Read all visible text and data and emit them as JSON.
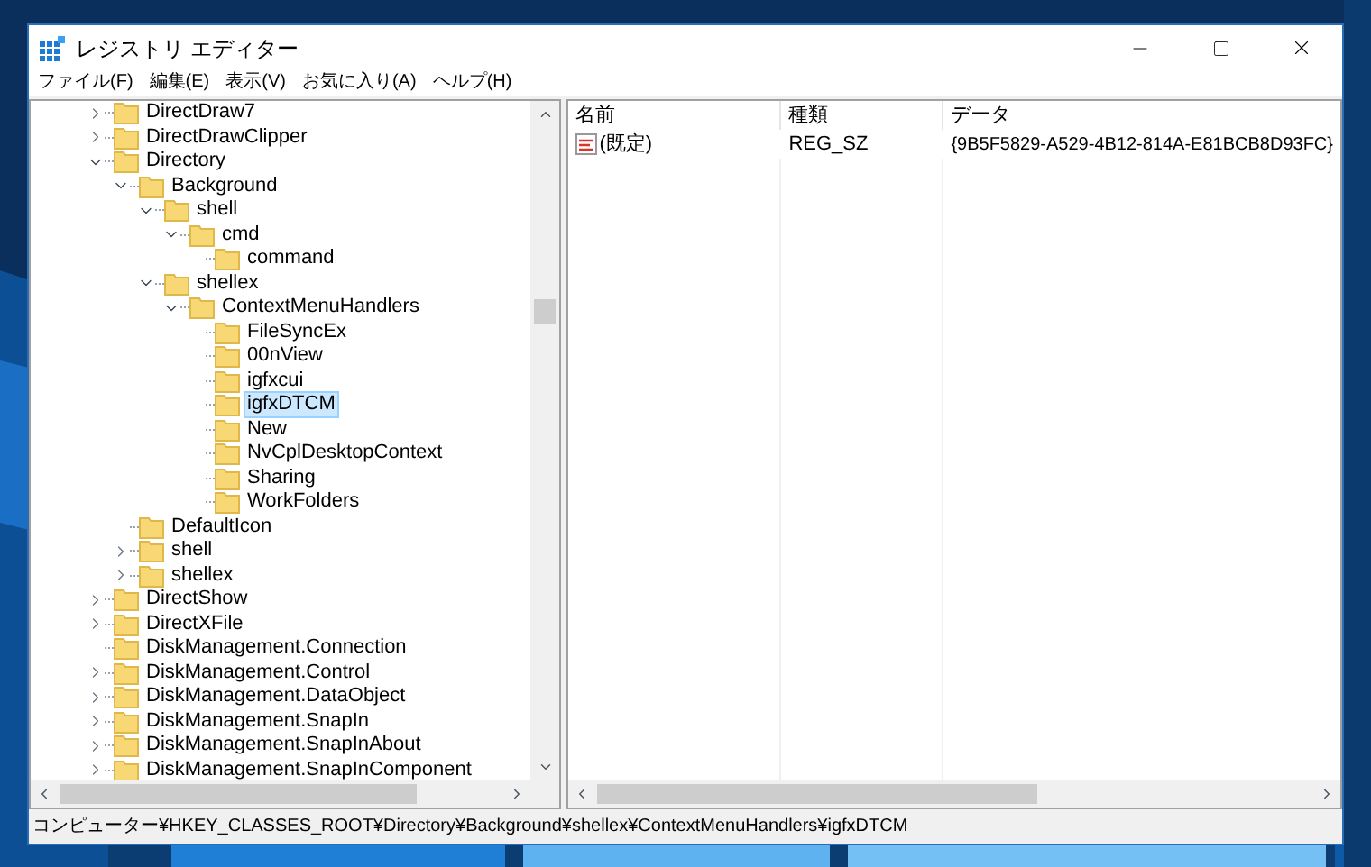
{
  "window": {
    "title": "レジストリ エディター"
  },
  "menu": [
    "ファイル(F)",
    "編集(E)",
    "表示(V)",
    "お気に入り(A)",
    "ヘルプ(H)"
  ],
  "tree": [
    {
      "name": "DirectDraw7",
      "expanded": false,
      "selected": false
    },
    {
      "name": "DirectDrawClipper",
      "expanded": false,
      "selected": false
    },
    {
      "name": "Directory",
      "expanded": true,
      "selected": false,
      "children": [
        {
          "name": "Background",
          "expanded": true,
          "selected": false,
          "children": [
            {
              "name": "shell",
              "expanded": true,
              "selected": false,
              "children": [
                {
                  "name": "cmd",
                  "expanded": true,
                  "selected": false,
                  "children": [
                    {
                      "name": "command",
                      "selected": false
                    }
                  ]
                }
              ]
            },
            {
              "name": "shellex",
              "expanded": true,
              "selected": false,
              "children": [
                {
                  "name": "ContextMenuHandlers",
                  "expanded": true,
                  "selected": false,
                  "children": [
                    {
                      "name": "FileSyncEx",
                      "selected": false
                    },
                    {
                      "name": "00nView",
                      "selected": false
                    },
                    {
                      "name": "igfxcui",
                      "selected": false
                    },
                    {
                      "name": "igfxDTCM",
                      "selected": true
                    },
                    {
                      "name": "New",
                      "selected": false
                    },
                    {
                      "name": "NvCplDesktopContext",
                      "selected": false
                    },
                    {
                      "name": "Sharing",
                      "selected": false
                    },
                    {
                      "name": "WorkFolders",
                      "selected": false
                    }
                  ]
                }
              ]
            }
          ]
        },
        {
          "name": "DefaultIcon",
          "selected": false
        },
        {
          "name": "shell",
          "expanded": false,
          "selected": false
        },
        {
          "name": "shellex",
          "expanded": false,
          "selected": false
        }
      ]
    },
    {
      "name": "DirectShow",
      "expanded": false,
      "selected": false
    },
    {
      "name": "DirectXFile",
      "expanded": false,
      "selected": false
    },
    {
      "name": "DiskManagement.Connection",
      "selected": false
    },
    {
      "name": "DiskManagement.Control",
      "expanded": false,
      "selected": false
    },
    {
      "name": "DiskManagement.DataObject",
      "expanded": false,
      "selected": false
    },
    {
      "name": "DiskManagement.SnapIn",
      "expanded": false,
      "selected": false
    },
    {
      "name": "DiskManagement.SnapInAbout",
      "expanded": false,
      "selected": false
    },
    {
      "name": "DiskManagement.SnapInComponent",
      "expanded": false,
      "selected": false
    }
  ],
  "values": {
    "columns": [
      "名前",
      "種類",
      "データ"
    ],
    "rows": [
      {
        "name": "(既定)",
        "type": "REG_SZ",
        "data": "{9B5F5829-A529-4B12-814A-E81BCB8D93FC}"
      }
    ]
  },
  "status_bar": "コンピューター¥HKEY_CLASSES_ROOT¥Directory¥Background¥shellex¥ContextMenuHandlers¥igfxDTCM"
}
